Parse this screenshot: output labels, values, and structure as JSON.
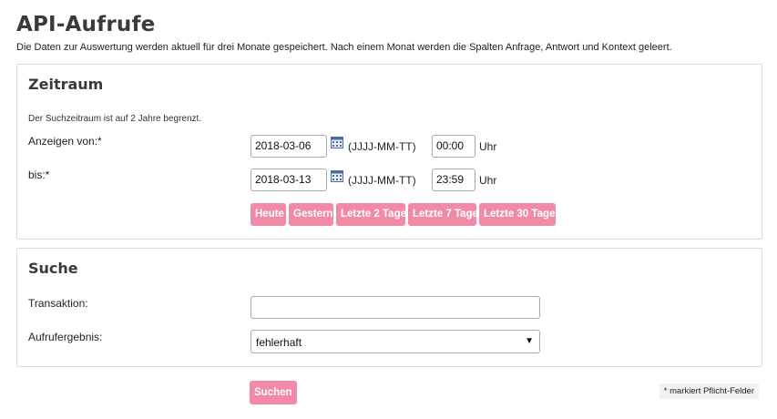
{
  "page": {
    "title": "API-Aufrufe",
    "subtitle": "Die Daten zur Auswertung werden aktuell für drei Monate gespeichert. Nach einem Monat werden die Spalten Anfrage, Antwort und Kontext geleert."
  },
  "zeitraum": {
    "heading": "Zeitraum",
    "note": "Der Suchzeitraum ist auf 2 Jahre begrenzt.",
    "from": {
      "label": "Anzeigen von:*",
      "date": "2018-03-06",
      "date_hint": "(JJJJ-MM-TT)",
      "time": "00:00",
      "time_unit": "Uhr",
      "calendar_icon": "calendar-icon"
    },
    "to": {
      "label": "bis:*",
      "date": "2018-03-13",
      "date_hint": "(JJJJ-MM-TT)",
      "time": "23:59",
      "time_unit": "Uhr",
      "calendar_icon": "calendar-icon"
    },
    "quick_buttons": [
      "Heute",
      "Gestern",
      "Letzte 2 Tage",
      "Letzte 7 Tage",
      "Letzte 30 Tage"
    ]
  },
  "suche": {
    "heading": "Suche",
    "transaction": {
      "label": "Transaktion:",
      "value": ""
    },
    "result": {
      "label": "Aufrufergebnis:",
      "selected": "fehlerhaft"
    }
  },
  "actions": {
    "search_label": "Suchen",
    "required_note": "* markiert Pflicht-Felder"
  },
  "colors": {
    "accent": "#f18aa6",
    "heading": "#3a3a3a",
    "border": "#dcdcdc"
  }
}
